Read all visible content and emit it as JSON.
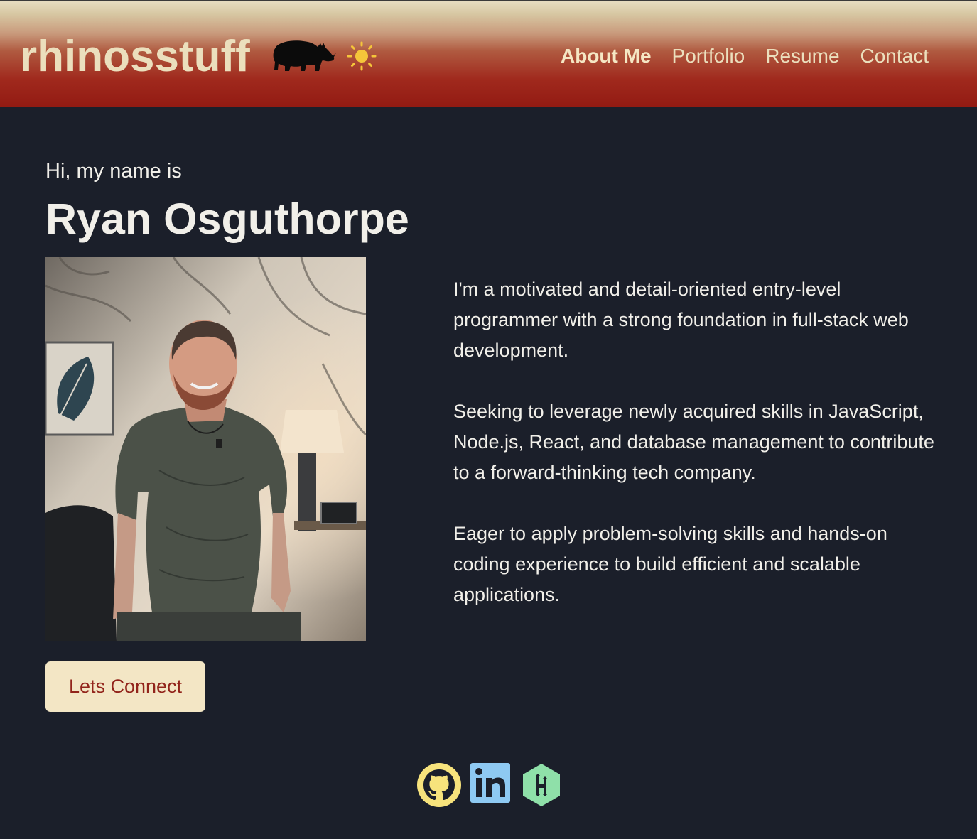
{
  "header": {
    "brand": "rhinosstuff",
    "nav": [
      {
        "label": "About Me",
        "active": true
      },
      {
        "label": "Portfolio",
        "active": false
      },
      {
        "label": "Resume",
        "active": false
      },
      {
        "label": "Contact",
        "active": false
      }
    ],
    "theme_toggle_icon": "sun-icon",
    "logo_icon": "rhino-icon"
  },
  "hero": {
    "greeting": "Hi, my name is",
    "name": "Ryan Osguthorpe",
    "photo_alt": "Ryan Osguthorpe",
    "bio": [
      "I'm a motivated and detail-oriented entry-level programmer with a strong foundation in full-stack web development.",
      "Seeking to leverage newly acquired skills in JavaScript, Node.js, React, and database management to contribute to a forward-thinking tech company.",
      "Eager to apply problem-solving skills and hands-on coding experience to build efficient and scalable applications."
    ],
    "cta_label": "Lets Connect"
  },
  "socials": [
    {
      "name": "GitHub",
      "icon": "github-icon",
      "color": "#f7e37c"
    },
    {
      "name": "LinkedIn",
      "icon": "linkedin-icon",
      "color": "#8ec9f2"
    },
    {
      "name": "HackerRank",
      "icon": "hackerrank-icon",
      "color": "#8fe0a9"
    }
  ],
  "colors": {
    "background": "#1b1f2a",
    "header_red": "#921a12",
    "header_cream": "#e6dcc0",
    "brand_text": "#ebdfbd",
    "button_bg": "#f3e6c5",
    "button_text": "#92241b"
  }
}
